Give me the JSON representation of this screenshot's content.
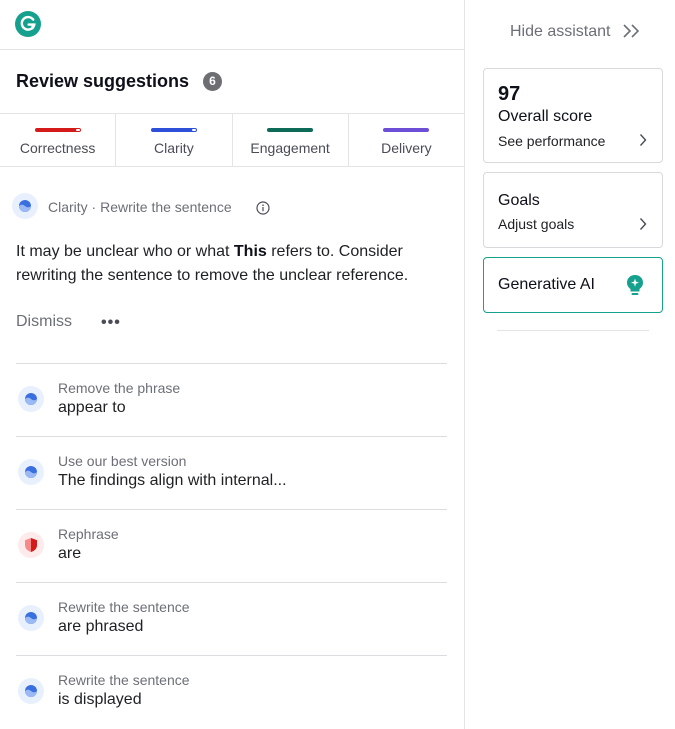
{
  "app": {
    "logo_icon": "grammarly-g-icon",
    "brand_color": "#15a18d"
  },
  "review": {
    "title": "Review suggestions",
    "count": "6"
  },
  "tabs": [
    {
      "label": "Correctness",
      "color": "#d51a1a",
      "partial": true
    },
    {
      "label": "Clarity",
      "color": "#2e4fd7",
      "partial": true
    },
    {
      "label": "Engagement",
      "color": "#0d6b57",
      "partial": false
    },
    {
      "label": "Delivery",
      "color": "#6d4fd7",
      "partial": false
    }
  ],
  "active_card": {
    "category_line": "Clarity · Rewrite the sentence",
    "text_before": "It may be unclear who or what ",
    "text_bold": "This",
    "text_after": " refers to. Consider rewriting the sentence to remove the unclear reference.",
    "dismiss_label": "Dismiss",
    "more_label": "•••"
  },
  "suggestions": [
    {
      "kind": "Remove the phrase",
      "value": "appear to",
      "icon": "clarity-icon",
      "color": "blue"
    },
    {
      "kind": "Use our best version",
      "value": "The findings align with internal...",
      "icon": "clarity-icon",
      "color": "blue"
    },
    {
      "kind": "Rephrase",
      "value": "are",
      "icon": "correctness-shield-icon",
      "color": "red"
    },
    {
      "kind": "Rewrite the sentence",
      "value": "are phrased",
      "icon": "clarity-icon",
      "color": "blue"
    },
    {
      "kind": "Rewrite the sentence",
      "value": "is displayed",
      "icon": "clarity-icon",
      "color": "blue"
    }
  ],
  "assistant": {
    "hide_label": "Hide assistant",
    "score": {
      "value": "97",
      "label": "Overall score",
      "link": "See performance"
    },
    "goals": {
      "title": "Goals",
      "link": "Adjust goals"
    },
    "generative": {
      "title": "Generative AI"
    }
  }
}
